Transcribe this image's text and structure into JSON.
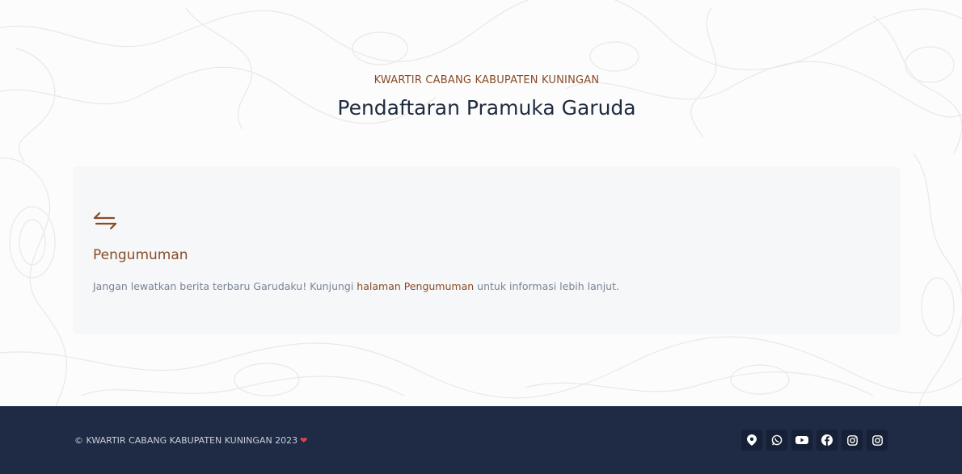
{
  "header": {
    "subtitle": "KWARTIR CABANG KABUPATEN KUNINGAN",
    "title": "Pendaftaran Pramuka Garuda"
  },
  "announcement": {
    "icon": "arrows-exchange-icon",
    "heading": "Pengumuman",
    "text_before": "Jangan lewatkan berita terbaru Garudaku! Kunjungi ",
    "link_text": "halaman Pengumuman",
    "text_after": " untuk informasi lebih lanjut."
  },
  "footer": {
    "copyright": "© KWARTIR CABANG KABUPATEN KUNINGAN 2023",
    "heart": "❤",
    "social": [
      {
        "icon": "map-pin-icon"
      },
      {
        "icon": "whatsapp-icon"
      },
      {
        "icon": "youtube-icon"
      },
      {
        "icon": "facebook-icon"
      },
      {
        "icon": "instagram-icon"
      },
      {
        "icon": "instagram-icon"
      }
    ]
  },
  "colors": {
    "accent": "#8a4b25",
    "footer_bg": "#1f2a44",
    "card_bg": "#f5f7f9",
    "heart": "#e0414c"
  }
}
